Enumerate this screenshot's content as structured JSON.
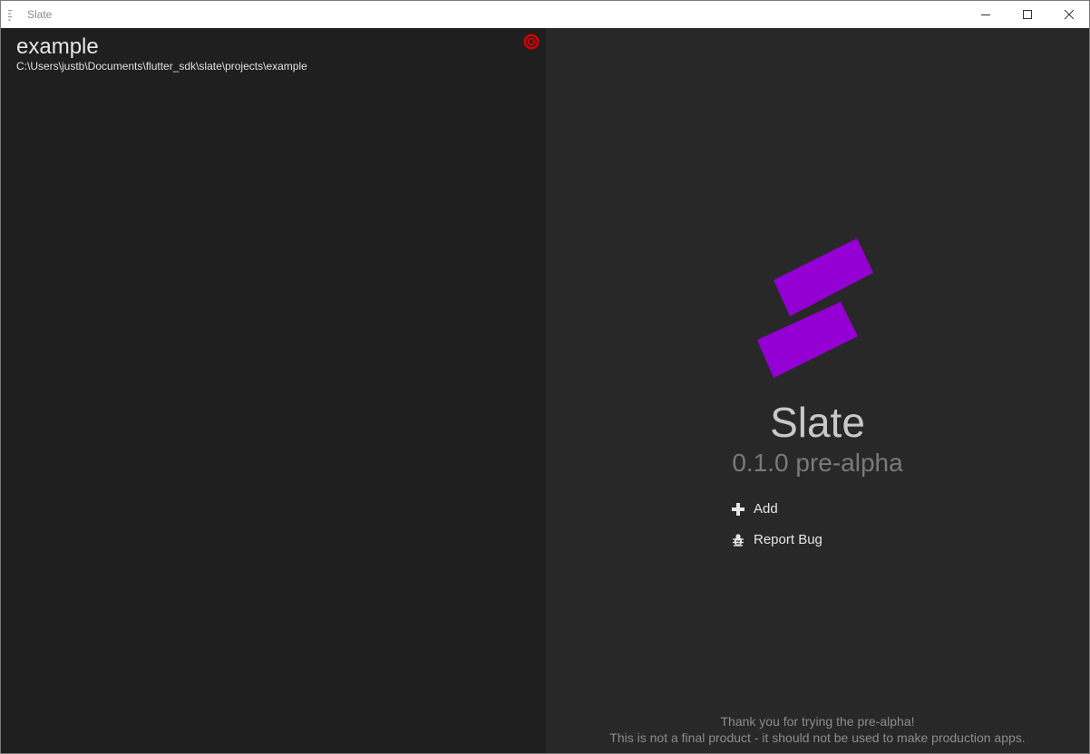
{
  "window": {
    "title": "Slate"
  },
  "project": {
    "name": "example",
    "path": "C:\\Users\\justb\\Documents\\flutter_sdk\\slate\\projects\\example"
  },
  "app": {
    "name": "Slate",
    "version": "0.1.0 pre-alpha"
  },
  "actions": {
    "add_label": "Add",
    "report_bug_label": "Report Bug"
  },
  "footer": {
    "line1": "Thank you for trying the pre-alpha!",
    "line2": "This is not a final product - it should not be used to make production apps."
  },
  "colors": {
    "accent": "#9400D3",
    "remove_red": "#d40000",
    "left_panel_bg": "#1f1f1f",
    "right_panel_bg": "#282828"
  },
  "icons": {
    "app": "app-menu-icon",
    "remove": "close-circle-icon",
    "add": "plus-icon",
    "bug": "bug-icon"
  }
}
